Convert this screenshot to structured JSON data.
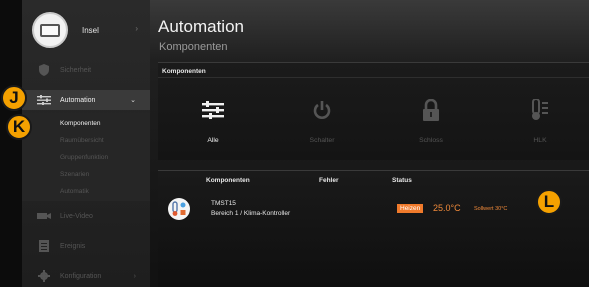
{
  "sidebar": {
    "profile_name": "Insel",
    "items": [
      {
        "label": "Sicherheit",
        "icon": "shield-icon"
      },
      {
        "label": "Automation",
        "icon": "sliders-icon"
      },
      {
        "label": "Live-Video",
        "icon": "camera-icon"
      },
      {
        "label": "Ereignis",
        "icon": "list-icon"
      },
      {
        "label": "Konfiguration",
        "icon": "gear-icon"
      }
    ],
    "sub_items": [
      "Komponenten",
      "Raumübersicht",
      "Gruppenfunktion",
      "Szenarien",
      "Automatik"
    ]
  },
  "badges": {
    "j": "J",
    "k": "K",
    "l": "L"
  },
  "header": {
    "title": "Automation",
    "subtitle": "Komponenten"
  },
  "categories_card": {
    "title": "Komponenten",
    "items": [
      {
        "label": "Alle",
        "icon": "sliders-icon"
      },
      {
        "label": "Schalter",
        "icon": "power-icon"
      },
      {
        "label": "Schloss",
        "icon": "lock-icon"
      },
      {
        "label": "HLK",
        "icon": "thermometer-icon"
      }
    ]
  },
  "table": {
    "columns": [
      "Komponenten",
      "Fehler",
      "Status"
    ],
    "rows": [
      {
        "name": "TMST15",
        "location": "Bereich 1 / Klima-Kontroller",
        "mode": "Heizen",
        "temperature": "25.0°C",
        "setpoint": "Sollwert 30°C"
      }
    ]
  },
  "colors": {
    "accent": "#f5a100",
    "heat": "#f07a2b"
  }
}
